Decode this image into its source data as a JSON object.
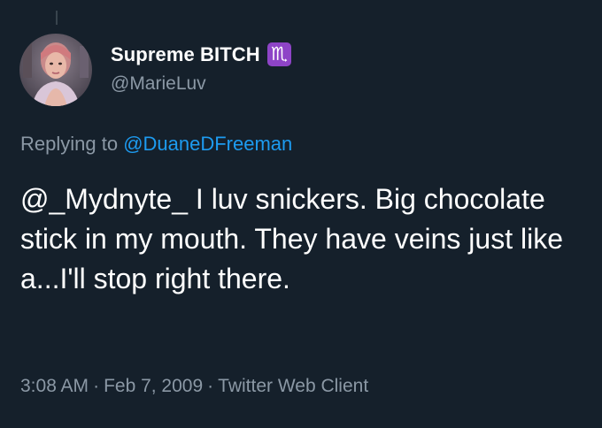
{
  "tweet": {
    "display_name": "Supreme BITCH",
    "badge_glyph": "♏",
    "badge_icon": "scorpio-zodiac-icon",
    "badge_color": "#8e44c7",
    "handle": "@MarieLuv",
    "replying_prefix": "Replying to ",
    "replying_mention": "@DuaneDFreeman",
    "text": "@_Mydnyte_ I luv snickers. Big chocolate stick in my mouth. They have veins just like a...I'll stop right there.",
    "time": "3:08 AM",
    "separator": "·",
    "date": "Feb 7, 2009",
    "source": "Twitter Web Client"
  },
  "colors": {
    "background": "#15202b",
    "primary_text": "#ffffff",
    "secondary_text": "#8b98a5",
    "link": "#1d9bf0"
  }
}
